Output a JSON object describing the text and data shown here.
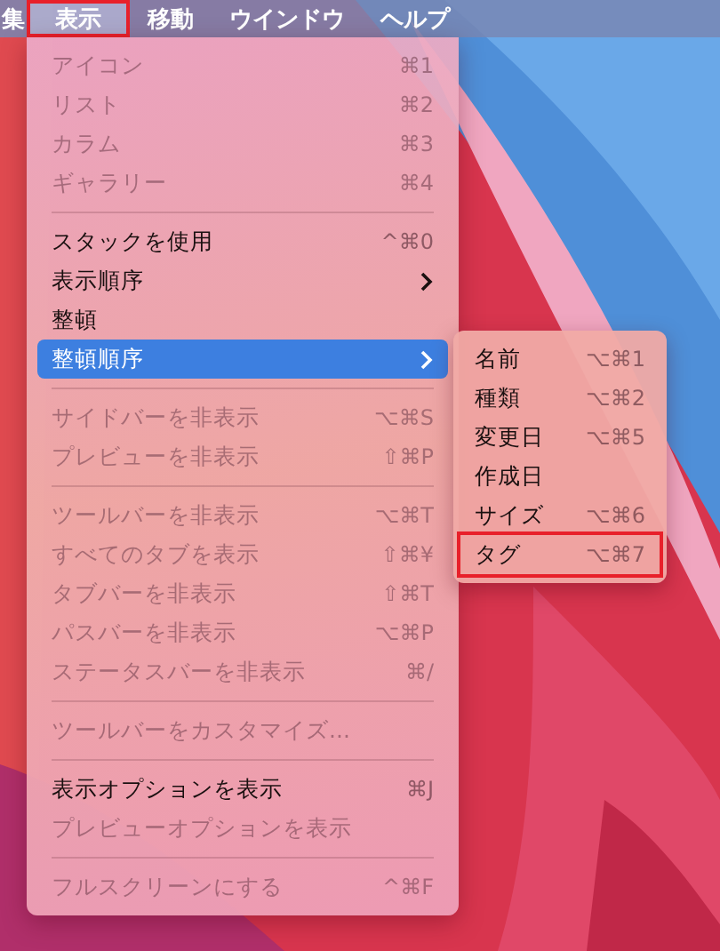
{
  "menu_bar": [
    {
      "label": "集",
      "selected": false,
      "annotated": false
    },
    {
      "label": "表示",
      "selected": true,
      "annotated": true
    },
    {
      "label": "移動",
      "selected": false,
      "annotated": false
    },
    {
      "label": "ウインドウ",
      "selected": false,
      "annotated": false
    },
    {
      "label": "ヘルプ",
      "selected": false,
      "annotated": false
    }
  ],
  "menu": {
    "items": [
      {
        "kind": "item",
        "label": "アイコン",
        "shortcut": "⌘1",
        "disabled": true,
        "selected": false
      },
      {
        "kind": "item",
        "label": "リスト",
        "shortcut": "⌘2",
        "disabled": true,
        "selected": false
      },
      {
        "kind": "item",
        "label": "カラム",
        "shortcut": "⌘3",
        "disabled": true,
        "selected": false
      },
      {
        "kind": "item",
        "label": "ギャラリー",
        "shortcut": "⌘4",
        "disabled": true,
        "selected": false
      },
      {
        "kind": "separator"
      },
      {
        "kind": "item",
        "label": "スタックを使用",
        "shortcut": "^⌘0",
        "disabled": false,
        "selected": false
      },
      {
        "kind": "submenu",
        "label": "表示順序",
        "disabled": false,
        "selected": false
      },
      {
        "kind": "item",
        "label": "整頓",
        "disabled": false,
        "selected": false
      },
      {
        "kind": "submenu",
        "label": "整頓順序",
        "disabled": false,
        "selected": true
      },
      {
        "kind": "separator"
      },
      {
        "kind": "item",
        "label": "サイドバーを非表示",
        "shortcut": "⌥⌘S",
        "disabled": true,
        "selected": false
      },
      {
        "kind": "item",
        "label": "プレビューを非表示",
        "shortcut": "⇧⌘P",
        "disabled": true,
        "selected": false
      },
      {
        "kind": "separator"
      },
      {
        "kind": "item",
        "label": "ツールバーを非表示",
        "shortcut": "⌥⌘T",
        "disabled": true,
        "selected": false
      },
      {
        "kind": "item",
        "label": "すべてのタブを表示",
        "shortcut": "⇧⌘¥",
        "disabled": true,
        "selected": false
      },
      {
        "kind": "item",
        "label": "タブバーを非表示",
        "shortcut": "⇧⌘T",
        "disabled": true,
        "selected": false
      },
      {
        "kind": "item",
        "label": "パスバーを非表示",
        "shortcut": "⌥⌘P",
        "disabled": true,
        "selected": false
      },
      {
        "kind": "item",
        "label": "ステータスバーを非表示",
        "shortcut": "⌘/",
        "disabled": true,
        "selected": false
      },
      {
        "kind": "separator"
      },
      {
        "kind": "item",
        "label": "ツールバーをカスタマイズ...",
        "disabled": true,
        "selected": false
      },
      {
        "kind": "separator"
      },
      {
        "kind": "item",
        "label": "表示オプションを表示",
        "shortcut": "⌘J",
        "disabled": false,
        "selected": false
      },
      {
        "kind": "item",
        "label": "プレビューオプションを表示",
        "disabled": true,
        "selected": false
      },
      {
        "kind": "separator"
      },
      {
        "kind": "item",
        "label": "フルスクリーンにする",
        "shortcut": "^⌘F",
        "disabled": true,
        "selected": false
      }
    ]
  },
  "submenu": {
    "items": [
      {
        "label": "名前",
        "shortcut": "⌥⌘1",
        "annotated": false
      },
      {
        "label": "種類",
        "shortcut": "⌥⌘2",
        "annotated": false
      },
      {
        "label": "変更日",
        "shortcut": "⌥⌘5",
        "annotated": false
      },
      {
        "label": "作成日",
        "annotated": false
      },
      {
        "label": "サイズ",
        "shortcut": "⌥⌘6",
        "annotated": false
      },
      {
        "label": "タグ",
        "shortcut": "⌥⌘7",
        "annotated": true
      }
    ]
  }
}
